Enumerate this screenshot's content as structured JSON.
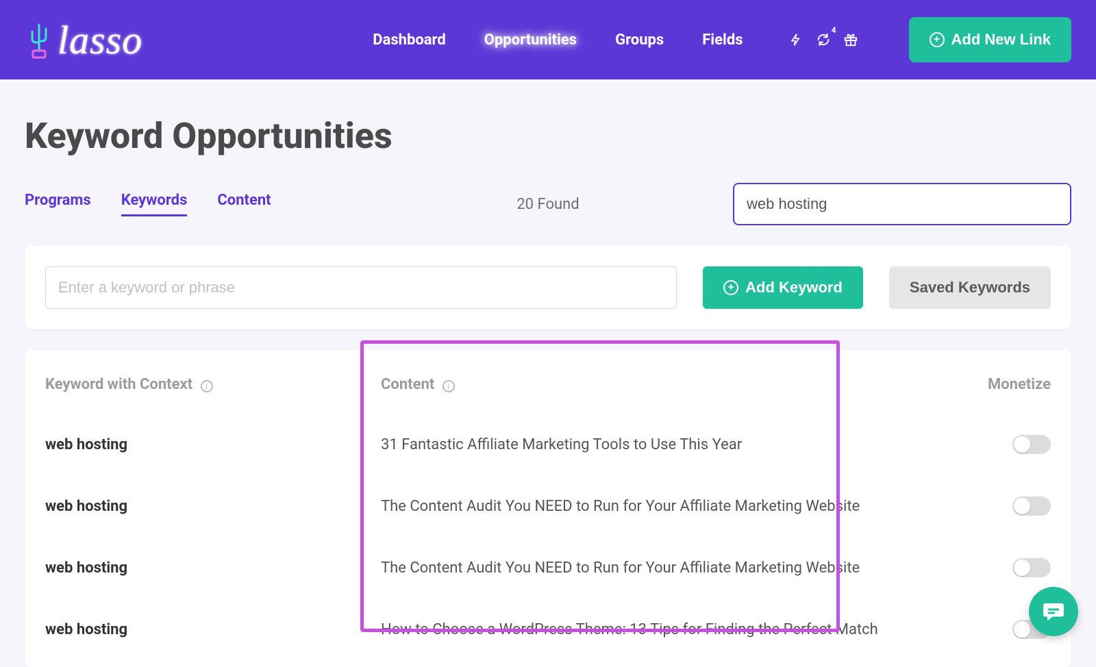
{
  "brand": {
    "name": "lasso"
  },
  "nav": {
    "items": [
      {
        "label": "Dashboard"
      },
      {
        "label": "Opportunities"
      },
      {
        "label": "Groups"
      },
      {
        "label": "Fields"
      }
    ],
    "sync_badge": "4"
  },
  "header_button": {
    "label": "Add New Link"
  },
  "page": {
    "title": "Keyword Opportunities"
  },
  "subnav": {
    "items": [
      {
        "label": "Programs"
      },
      {
        "label": "Keywords"
      },
      {
        "label": "Content"
      }
    ],
    "found_text": "20 Found",
    "search_value": "web hosting"
  },
  "keyword_form": {
    "placeholder": "Enter a keyword or phrase",
    "add_label": "Add Keyword",
    "saved_label": "Saved Keywords"
  },
  "table": {
    "headers": {
      "keyword": "Keyword with Context",
      "content": "Content",
      "monetize": "Monetize"
    },
    "rows": [
      {
        "keyword": "web hosting",
        "content": "31 Fantastic Affiliate Marketing Tools to Use This Year"
      },
      {
        "keyword": "web hosting",
        "content": "The Content Audit You NEED to Run for Your Affiliate Marketing Website"
      },
      {
        "keyword": "web hosting",
        "content": "The Content Audit You NEED to Run for Your Affiliate Marketing Website"
      },
      {
        "keyword": "web hosting",
        "content": "How to Choose a WordPress Theme: 13 Tips for Finding the Perfect Match"
      }
    ]
  }
}
